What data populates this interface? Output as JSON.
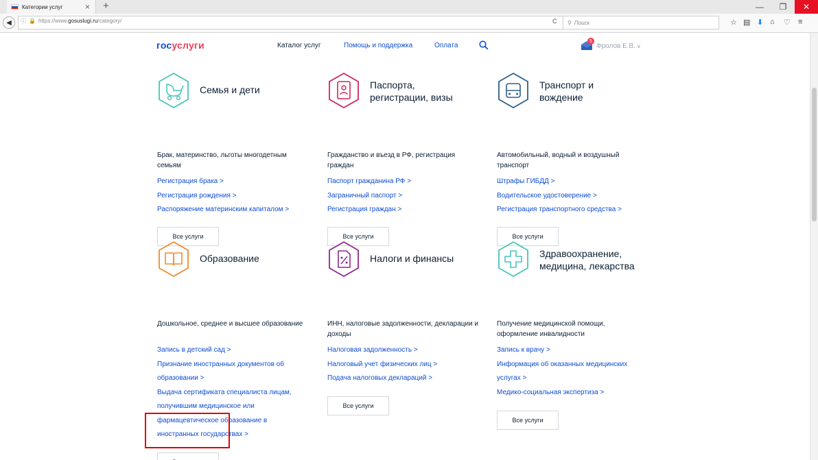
{
  "browser": {
    "tab_title": "Категории услуг",
    "tab_close": "×",
    "new_tab": "+",
    "url_prefix": "https://www.",
    "url_domain": "gosuslugi.ru",
    "url_path": "/category/",
    "search_placeholder": "Поиск"
  },
  "header": {
    "logo_part1": "гос",
    "logo_part2": "услуги",
    "nav": {
      "catalog": "Каталог услуг",
      "help": "Помощь и поддержка",
      "payment": "Оплата"
    },
    "user_name": "Фролов Е.В.",
    "notification_count": "5"
  },
  "categories": [
    {
      "title_line1": "Семья и дети",
      "title_line2": "",
      "description": "Брак, материнство, льготы многодетным семьям",
      "links": [
        "Регистрация брака >",
        "Регистрация рождения >",
        "Распоряжение материнским капиталом >"
      ],
      "button": "Все услуги",
      "color": "#47c5b9"
    },
    {
      "title_line1": "Паспорта,",
      "title_line2": "регистрации, визы",
      "description": "Гражданство и въезд в РФ, регистрация граждан",
      "links": [
        "Паспорт гражданина РФ >",
        "Заграничный паспорт >",
        "Регистрация граждан >"
      ],
      "button": "Все услуги",
      "color": "#d2245a"
    },
    {
      "title_line1": "Транспорт и",
      "title_line2": "вождение",
      "description": "Автомобильный, водный и воздушный транспорт",
      "links": [
        "Штрафы ГИБДД >",
        "Водительское удостоверение >",
        "Регистрация транспортного средства >"
      ],
      "button": "Все услуги",
      "color": "#2e5f8a"
    },
    {
      "title_line1": "Образование",
      "title_line2": "",
      "description": "Дошкольное, среднее и высшее образование",
      "links": [
        "Запись в детский сад >",
        "Признание иностранных документов об",
        "образовании >",
        "Выдача сертификата специалиста лицам,",
        "получившим медицинское или",
        "фармацевтическое образование в",
        "иностранных государствах >"
      ],
      "button": "Все услуги",
      "color": "#ef8a2d"
    },
    {
      "title_line1": "Налоги и финансы",
      "title_line2": "",
      "description": "ИНН, налоговые задолженности, декларации и доходы",
      "links": [
        "Налоговая задолженность >",
        "Налоговый учет физических лиц >",
        "Подача налоговых деклараций >"
      ],
      "button": "Все услуги",
      "color": "#8d2a8e"
    },
    {
      "title_line1": "Здравоохранение,",
      "title_line2": "медицина, лекарства",
      "description": "Получение медицинской помощи, оформление инвалидности",
      "links": [
        "Запись к врачу >",
        "Информация об оказанных медицинских",
        "услугах >",
        "Медико-социальная экспертиза >"
      ],
      "button": "Все услуги",
      "color": "#47c5b9"
    }
  ]
}
